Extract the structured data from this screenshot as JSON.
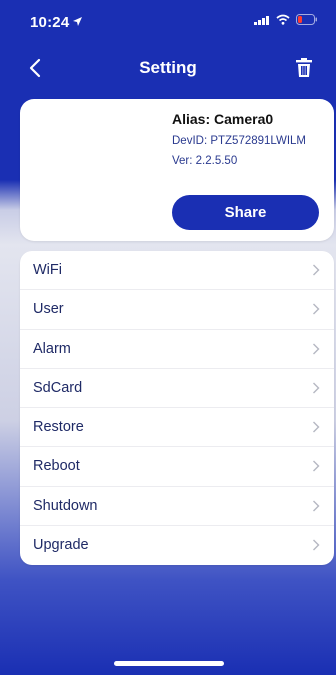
{
  "status": {
    "time": "10:24"
  },
  "nav": {
    "title": "Setting"
  },
  "device": {
    "alias": "Alias: Camera0",
    "devid": "DevID: PTZ572891LWILM",
    "version": "Ver: 2.2.5.50",
    "share_label": "Share"
  },
  "menu": {
    "items": [
      {
        "label": "WiFi"
      },
      {
        "label": "User"
      },
      {
        "label": "Alarm"
      },
      {
        "label": "SdCard"
      },
      {
        "label": "Restore"
      },
      {
        "label": "Reboot"
      },
      {
        "label": "Shutdown"
      },
      {
        "label": "Upgrade"
      }
    ]
  },
  "colors": {
    "brand": "#1a2fb3",
    "battery_low": "#ff3b30"
  },
  "icons": {
    "back": "chevron-left-icon",
    "delete": "trash-icon",
    "chevron": "chevron-right-icon",
    "location": "location-arrow-icon",
    "signal": "cellular-signal-icon",
    "wifi": "wifi-icon",
    "battery": "battery-icon"
  }
}
